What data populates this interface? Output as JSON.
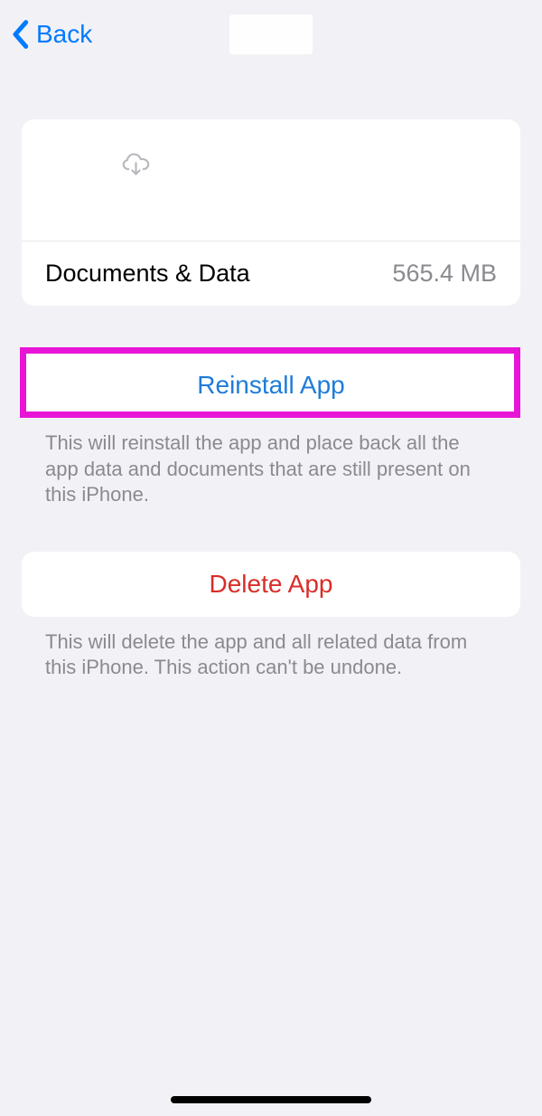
{
  "nav": {
    "back_label": "Back"
  },
  "appHeader": {
    "icon": "cloud-download-icon"
  },
  "storage": {
    "label": "Documents & Data",
    "value": "565.4 MB"
  },
  "reinstall": {
    "button_label": "Reinstall App",
    "description": "This will reinstall the app and place back all the app data and documents that are still present on this iPhone."
  },
  "delete": {
    "button_label": "Delete App",
    "description": "This will delete the app and all related data from this iPhone. This action can't be undone."
  }
}
